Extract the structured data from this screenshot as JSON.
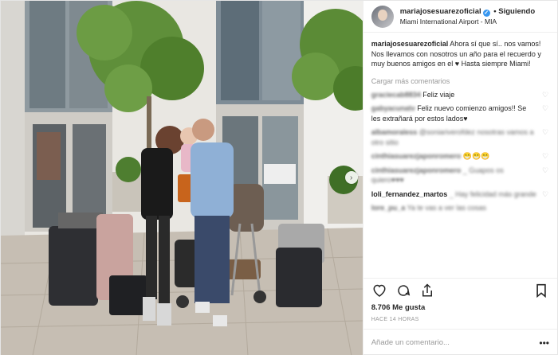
{
  "header": {
    "username": "mariajosesuarezoficial",
    "separator": "•",
    "follow_label": "Siguiendo",
    "location": "Miami International Airport - MIA",
    "verified_glyph": "✓"
  },
  "caption": {
    "username": "mariajosesuarezoficial",
    "text": "Ahora sí que sí.. nos vamos! Nos llevamos con nosotros un año para el recuerdo y muy buenos amigos en el ♥ Hasta siempre Miami!"
  },
  "load_more": "Cargar más comentarios",
  "comments": [
    {
      "user": "graciecab8834",
      "text": "Feliz viaje"
    },
    {
      "user": "gabyacunatv",
      "text": "Feliz nuevo comienzo amigos!! Se les extrañará por estos lados♥"
    },
    {
      "user": "albamoraless",
      "text": "@soniariverofdez nosotras vamos a otro sitio"
    },
    {
      "user": "cinthiasuarezjaponromero",
      "text": "😁😁😁 "
    },
    {
      "user": "cinthiasuarezjaponromero",
      "text": "_ Guapos os quiero♥♥♥"
    },
    {
      "user": "loli_fernandez_martos",
      "text": "_ Hay felicidad más grande"
    },
    {
      "user": "lore_pu_a",
      "text": "Ya te vas a ver las cosas"
    }
  ],
  "likes": "8.706 Me gusta",
  "timestamp": "HACE 14 HORAS",
  "add_comment_placeholder": "Añade un comentario...",
  "more_glyph": "•••",
  "next_glyph": "›",
  "heart_glyph": "♡",
  "colors": {
    "link": "#3897f0",
    "text": "#262626",
    "muted": "#999999"
  }
}
